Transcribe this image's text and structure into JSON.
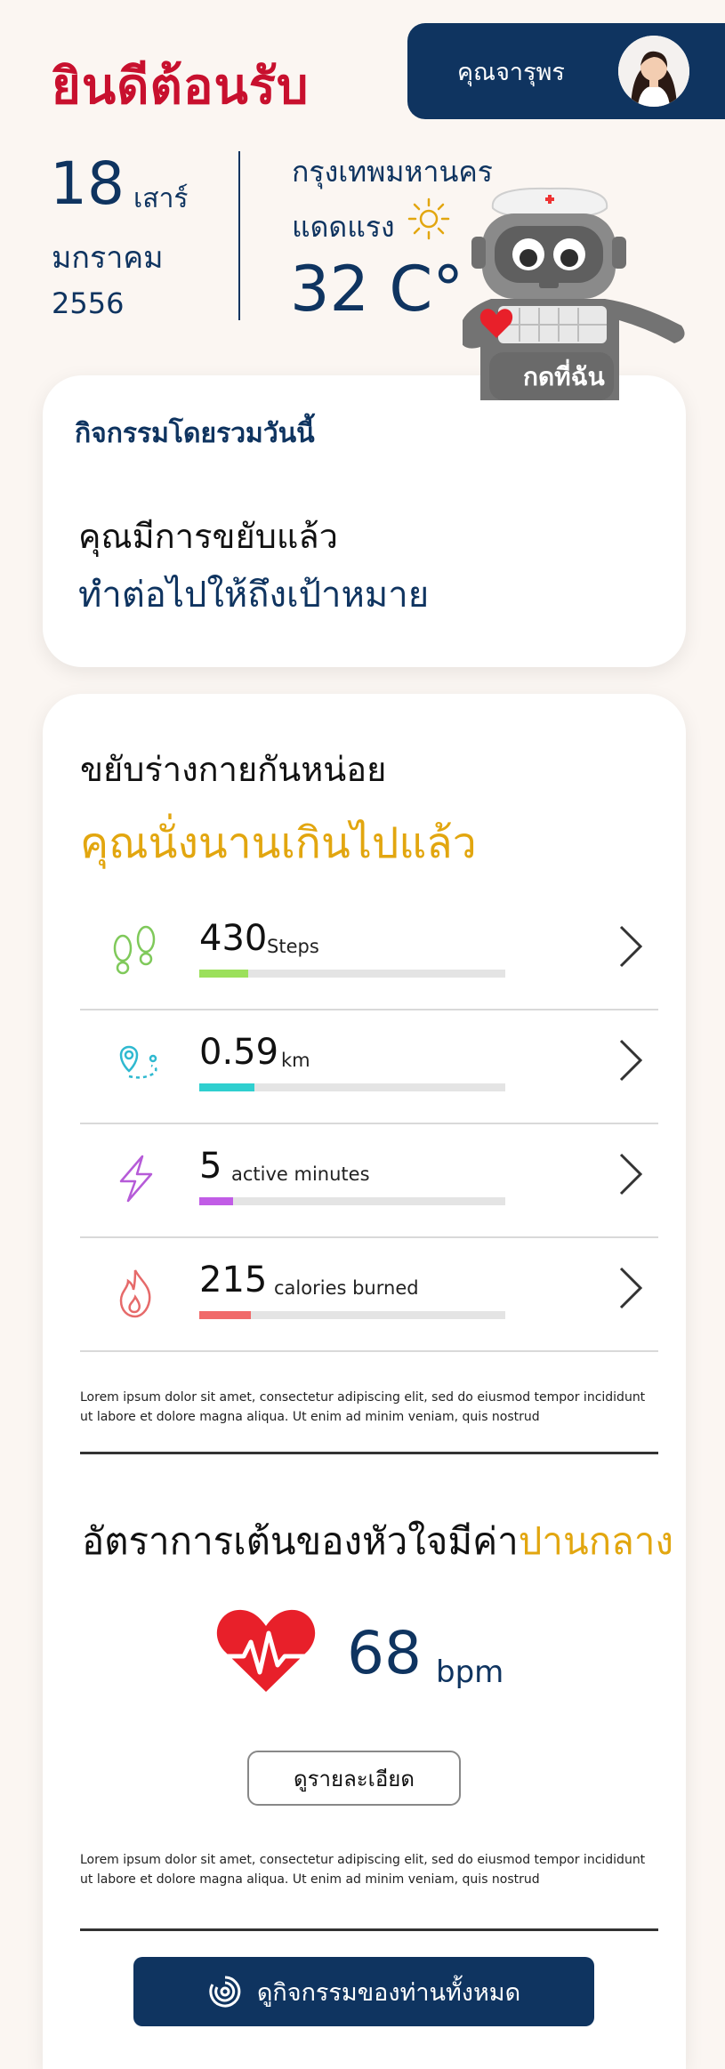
{
  "header": {
    "welcome": "ยินดีต้อนรับ",
    "user_name": "คุณจารุพร"
  },
  "date": {
    "day": "18",
    "weekday": "เสาร์",
    "month": "มกราคม",
    "year": "2556"
  },
  "weather": {
    "city": "กรุงเทพมหานคร",
    "condition": "แดดแรง",
    "temperature": "32 C°",
    "icon": "sun-icon"
  },
  "robot": {
    "label": "กดที่ฉัน"
  },
  "overview": {
    "title": "กิจกรรมโดยรวมวันนี้",
    "line1": "คุณมีการขยับแล้ว",
    "line2": "ทำต่อไปให้ถึงเป้าหมาย"
  },
  "activity": {
    "title": "ขยับร่างกายกันหน่อย",
    "subtitle": "คุณนั่งนานเกินไปแล้ว",
    "metrics": [
      {
        "value": "430",
        "unit": "Steps",
        "progress": 0.16,
        "color": "#9be05b",
        "icon": "footsteps-icon"
      },
      {
        "value": "0.59",
        "unit": "km",
        "progress": 0.18,
        "color": "#2fcfcf",
        "icon": "route-pin-icon"
      },
      {
        "value": "5",
        "unit": "active minutes",
        "progress": 0.11,
        "color": "#c15ce6",
        "icon": "lightning-icon"
      },
      {
        "value": "215",
        "unit": "calories burned",
        "progress": 0.17,
        "color": "#f06a6a",
        "icon": "flame-icon"
      }
    ],
    "note": "Lorem ipsum dolor sit amet, consectetur adipiscing elit, sed do eiusmod tempor incididunt ut labore et dolore magna aliqua. Ut enim ad minim veniam, quis nostrud"
  },
  "heart_rate": {
    "title_prefix": "อัตราการเต้นของหัวใจมีค่า",
    "title_highlight": "ปานกลาง",
    "value": "68",
    "unit": "bpm",
    "detail_button": "ดูรายละเอียด",
    "note": "Lorem ipsum dolor sit amet, consectetur adipiscing elit, sed do eiusmod tempor incididunt ut labore et dolore magna aliqua. Ut enim ad minim veniam, quis nostrud"
  },
  "footer": {
    "all_activities_button": "ดูกิจกรรมของท่านทั้งหมด"
  },
  "colors": {
    "brand_navy": "#0f3460",
    "welcome_red": "#c8102e",
    "accent_yellow": "#e2a60f",
    "heart_red": "#e8202a"
  }
}
